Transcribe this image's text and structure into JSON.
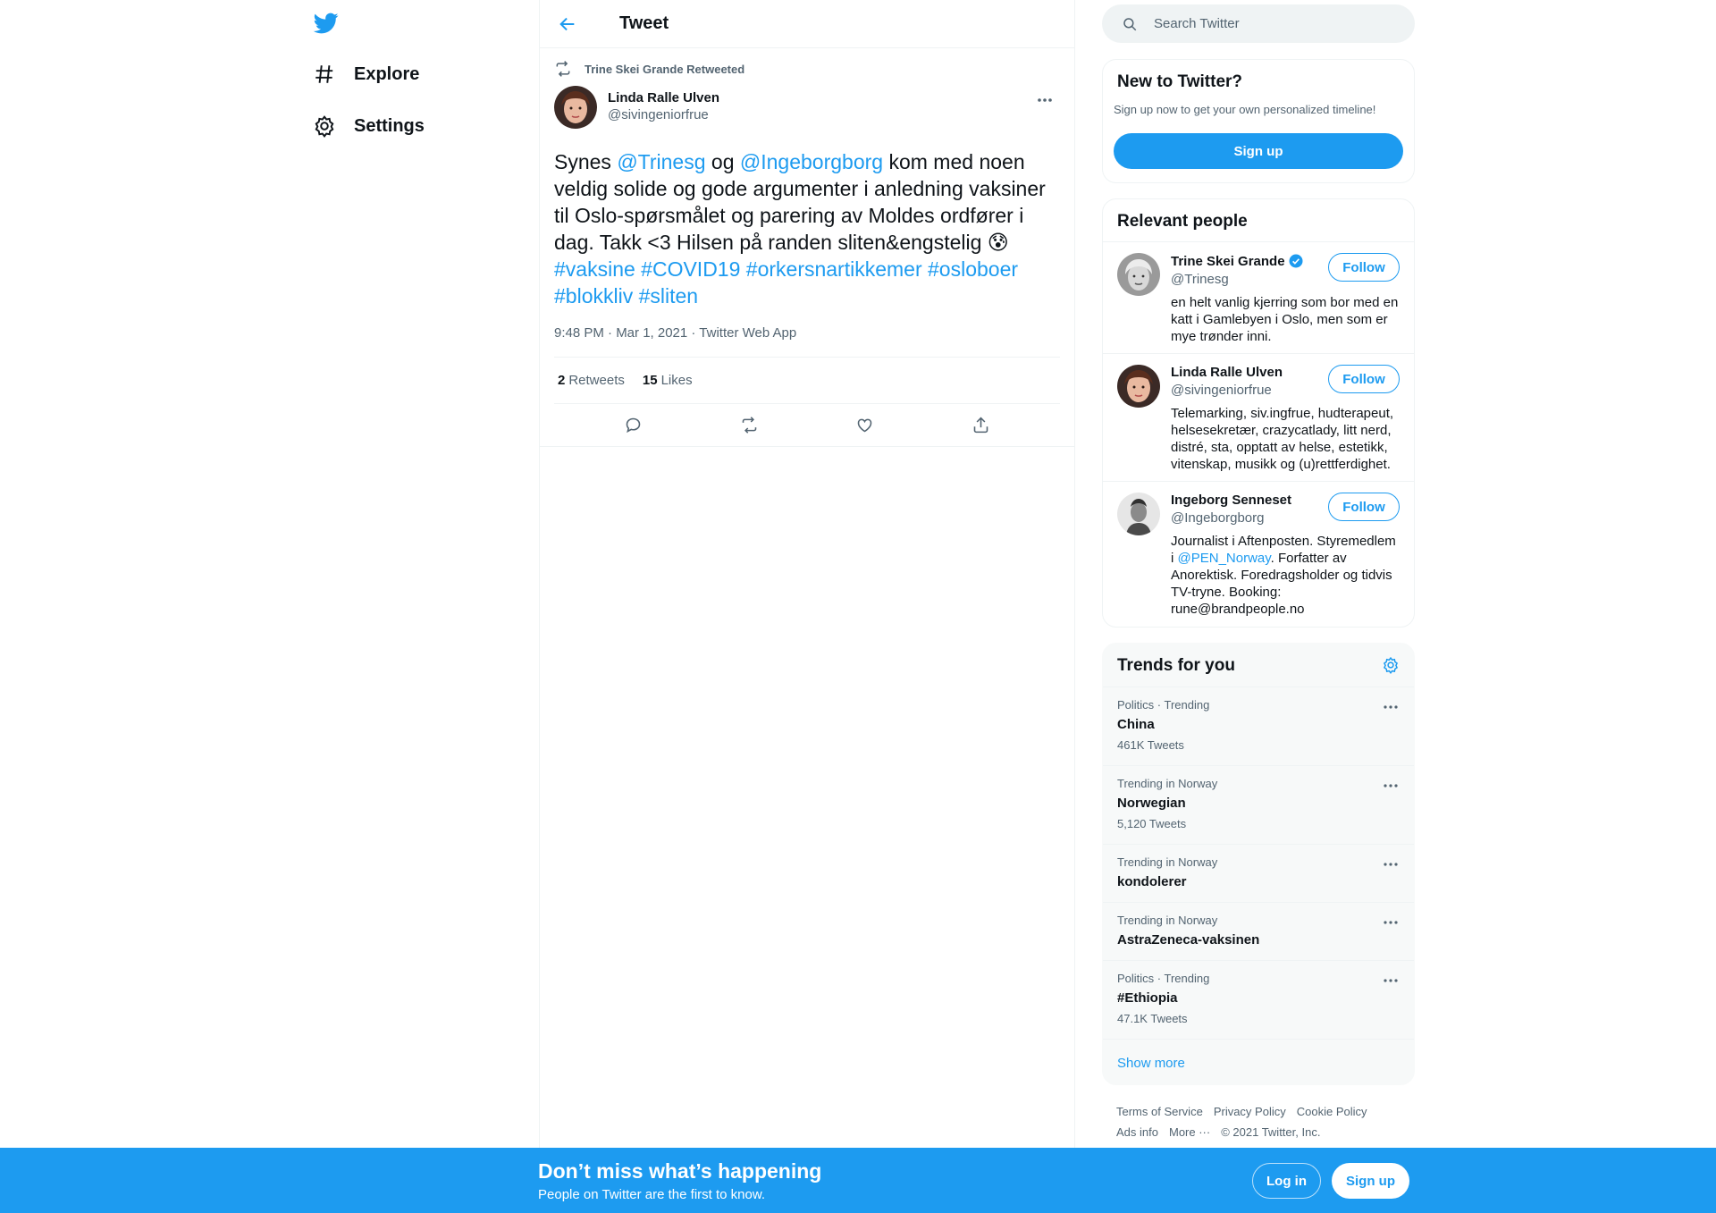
{
  "nav": {
    "logo_icon": "twitter-bird-icon",
    "items": [
      {
        "label": "Explore",
        "icon": "hashtag-icon"
      },
      {
        "label": "Settings",
        "icon": "gear-icon"
      }
    ]
  },
  "header": {
    "title": "Tweet"
  },
  "tweet": {
    "retweeted_by": "Trine Skei Grande Retweeted",
    "author_name": "Linda Ralle Ulven",
    "author_handle": "@sivingeniorfrue",
    "text_parts": {
      "p1": "Synes ",
      "m1": "@Trinesg",
      "p2": " og ",
      "m2": "@Ingeborgborg",
      "p3": " kom med noen veldig solide og gode argumenter i anledning vaksiner til Oslo-spørsmålet og parering av Moldes ordfører i dag. Takk <3 Hilsen på randen sliten&engstelig 😰",
      "h1": "#vaksine",
      "h2": "#COVID19",
      "h3": "#orkersnartikkemer",
      "h4": "#osloboer",
      "h5": "#blokkliv",
      "h6": "#sliten"
    },
    "meta": "9:48 PM · Mar 1, 2021 · Twitter Web App",
    "retweets_count": "2",
    "retweets_label": "Retweets",
    "likes_count": "15",
    "likes_label": "Likes"
  },
  "search": {
    "placeholder": "Search Twitter"
  },
  "new_card": {
    "title": "New to Twitter?",
    "text": "Sign up now to get your own personalized timeline!",
    "button": "Sign up"
  },
  "people": {
    "title": "Relevant people",
    "follow_label": "Follow",
    "list": [
      {
        "name": "Trine Skei Grande",
        "handle": "@Trinesg",
        "bio": "en helt vanlig kjerring som bor med en katt i Gamlebyen i Oslo, men som er mye trønder inni.",
        "verified": true
      },
      {
        "name": "Linda Ralle Ulven",
        "handle": "@sivingeniorfrue",
        "bio": "Telemarking, siv.ingfrue, hudterapeut, helsesekretær, crazycatlady, litt nerd, distré, sta, opptatt av helse, estetikk, vitenskap, musikk og (u)rettferdighet."
      },
      {
        "name": "Ingeborg Senneset",
        "handle": "@Ingeborgborg",
        "bio_pre": "Journalist i Aftenposten. Styremedlem i ",
        "bio_link": "@PEN_Norway",
        "bio_post": ". Forfatter av Anorektisk. Foredragsholder og tidvis TV-tryne. Booking: rune@brandpeople.no"
      }
    ]
  },
  "trends": {
    "title": "Trends for you",
    "items": [
      {
        "context": "Politics · Trending",
        "title": "China",
        "count": "461K Tweets"
      },
      {
        "context": "Trending in Norway",
        "title": "Norwegian",
        "count": "5,120 Tweets"
      },
      {
        "context": "Trending in Norway",
        "title": "kondolerer"
      },
      {
        "context": "Trending in Norway",
        "title": "AstraZeneca-vaksinen"
      },
      {
        "context": "Politics · Trending",
        "title": "#Ethiopia",
        "count": "47.1K Tweets"
      }
    ],
    "show_more": "Show more"
  },
  "footer": {
    "links": [
      "Terms of Service",
      "Privacy Policy",
      "Cookie Policy",
      "Ads info",
      "More ···"
    ],
    "copyright": "© 2021 Twitter, Inc."
  },
  "bottom_bar": {
    "title": "Don’t miss what’s happening",
    "subtitle": "People on Twitter are the first to know.",
    "login": "Log in",
    "signup": "Sign up"
  },
  "colors": {
    "accent": "#1d9bf0",
    "text": "#0f1419",
    "muted": "#536471"
  }
}
